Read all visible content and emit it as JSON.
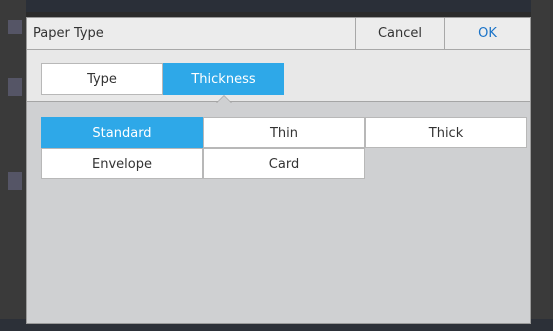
{
  "dialog": {
    "title": "Paper Type",
    "cancel_label": "Cancel",
    "ok_label": "OK"
  },
  "tabs": [
    {
      "label": "Type",
      "selected": false
    },
    {
      "label": "Thickness",
      "selected": true
    }
  ],
  "options": [
    {
      "label": "Standard",
      "selected": true
    },
    {
      "label": "Thin",
      "selected": false
    },
    {
      "label": "Thick",
      "selected": false
    },
    {
      "label": "Envelope",
      "selected": false
    },
    {
      "label": "Card",
      "selected": false
    }
  ],
  "colors": {
    "accent": "#2ea8e8",
    "ok_text": "#1a73c8",
    "dialog_body": "#cfd0d2"
  }
}
